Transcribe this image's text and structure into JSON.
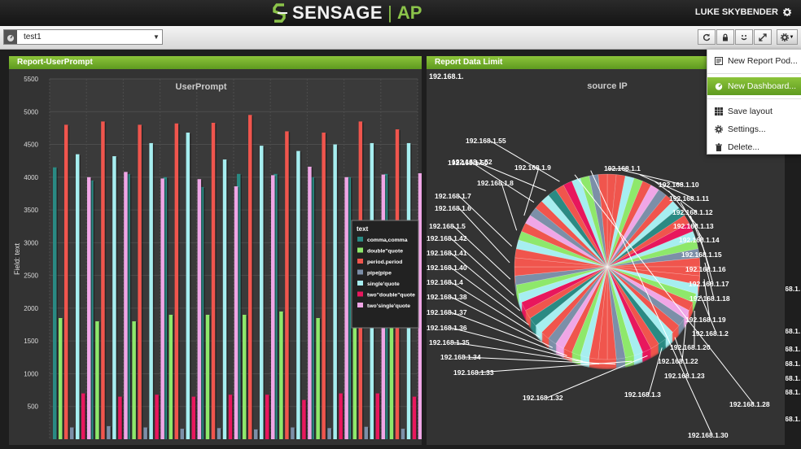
{
  "app": {
    "brand": "SENSAGE",
    "product": "AP",
    "user": "LUKE SKYBENDER"
  },
  "toolbar": {
    "dashboard_value": "test1",
    "buttons": [
      "refresh-icon",
      "lock-icon",
      "smile-icon",
      "expand-icon"
    ]
  },
  "menu": {
    "items": [
      {
        "label": "New Report Pod..."
      },
      {
        "label": "New Dashboard..."
      },
      {
        "label": "Save layout"
      },
      {
        "label": "Settings..."
      },
      {
        "label": "Delete..."
      }
    ]
  },
  "colors": {
    "accent": "#7cb431",
    "series": [
      "#2a8a83",
      "#8ee86b",
      "#f0554d",
      "#7c8fa8",
      "#a6eef0",
      "#e8175d",
      "#f0a6e6"
    ]
  },
  "pods": [
    {
      "title": "Report-UserPrompt"
    },
    {
      "title": "Report Data Limit",
      "header_extra": "192.168.1.",
      "chart_title": "source IP"
    }
  ],
  "chart_data": [
    {
      "type": "bar",
      "title": "UserPrompt",
      "ylabel": "Field: text",
      "ylim": [
        0,
        5500
      ],
      "yticks": [
        500,
        1000,
        1500,
        2000,
        2500,
        3000,
        3500,
        4000,
        4500,
        5000,
        5500
      ],
      "legend_title": "text",
      "legend_placement": "right",
      "groups": 10,
      "series": [
        {
          "name": "comma,comma",
          "color": "#2a8a83",
          "values": [
            4150,
            3950,
            4050,
            4000,
            3850,
            4050,
            4050,
            4000,
            4000,
            4050
          ]
        },
        {
          "name": "double\"quote",
          "color": "#8ee86b",
          "values": [
            1850,
            1800,
            1800,
            1900,
            1900,
            1900,
            1950,
            1850,
            1750,
            1850
          ]
        },
        {
          "name": "period.period",
          "color": "#f0554d",
          "values": [
            4800,
            4850,
            4800,
            4820,
            4830,
            4950,
            4700,
            4680,
            4850,
            4730
          ]
        },
        {
          "name": "pipe|pipe",
          "color": "#7c8fa8",
          "values": [
            180,
            200,
            180,
            160,
            170,
            150,
            180,
            170,
            190,
            160
          ]
        },
        {
          "name": "single'quote",
          "color": "#a6eef0",
          "values": [
            4350,
            4320,
            4520,
            4680,
            4270,
            4480,
            4400,
            4500,
            4520,
            4520
          ]
        },
        {
          "name": "two\"double\"quote",
          "color": "#e8175d",
          "values": [
            700,
            650,
            680,
            650,
            680,
            680,
            600,
            700,
            700,
            650
          ]
        },
        {
          "name": "two'single'quote",
          "color": "#f0a6e6",
          "values": [
            4000,
            4080,
            3980,
            3970,
            3860,
            4030,
            4160,
            4000,
            4040,
            4060
          ]
        }
      ]
    },
    {
      "type": "pie",
      "title": "source IP",
      "labels": [
        "192.168.1.1",
        "192.168.1.10",
        "192.168.1.11",
        "192.168.1.12",
        "192.168.1.13",
        "192.168.1.14",
        "192.168.1.15",
        "192.168.1.16",
        "192.168.1.17",
        "192.168.1.18",
        "192.168.1.19",
        "192.168.1.2",
        "192.168.1.20",
        "192.168.1.22",
        "192.168.1.23",
        "192.168.1.3",
        "192.168.1.32",
        "192.168.1.33",
        "192.168.1.34",
        "192.168.1.35",
        "192.168.1.36",
        "192.168.1.37",
        "192.168.1.38",
        "192.168.1.4",
        "192.168.1.40",
        "192.168.1.41",
        "192.168.1.42",
        "192.168.1.5",
        "192.168.1.6",
        "192.168.1.7",
        "192.168.1.8",
        "192.168.1.9",
        "192.168.1.50",
        "192.168.1.52",
        "192.168.1.55",
        "192.168.1.28",
        "192.168.1.30"
      ]
    }
  ]
}
